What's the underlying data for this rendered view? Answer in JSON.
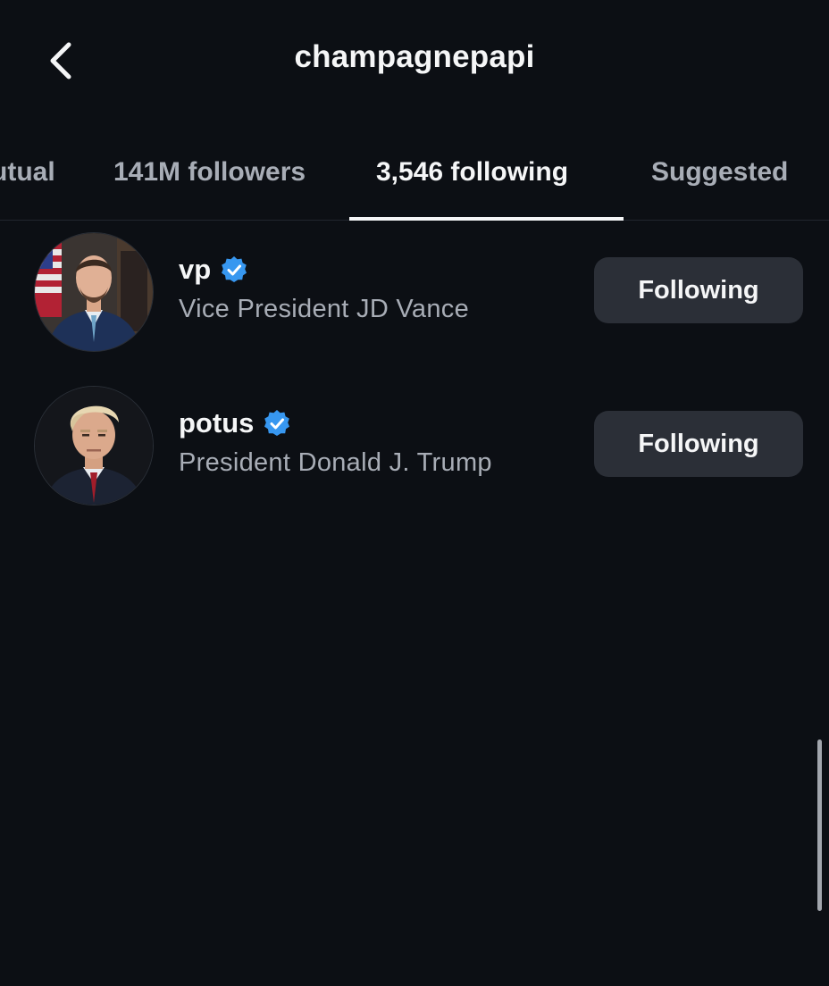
{
  "header": {
    "title": "champagnepapi",
    "back_icon": "chevron-left-icon"
  },
  "tabs": [
    {
      "label": "utual",
      "active": false
    },
    {
      "label": "141M followers",
      "active": false
    },
    {
      "label": "3,546 following",
      "active": true
    },
    {
      "label": "Suggested",
      "active": false
    }
  ],
  "accounts": [
    {
      "username": "vp",
      "full_name": "Vice President JD Vance",
      "verified": true,
      "button_label": "Following"
    },
    {
      "username": "potus",
      "full_name": "President Donald J. Trump",
      "verified": true,
      "button_label": "Following"
    }
  ],
  "colors": {
    "background": "#0c0f14",
    "button_bg": "#2b2f37",
    "verified_blue": "#3797f0",
    "secondary_text": "#a8adb6"
  }
}
